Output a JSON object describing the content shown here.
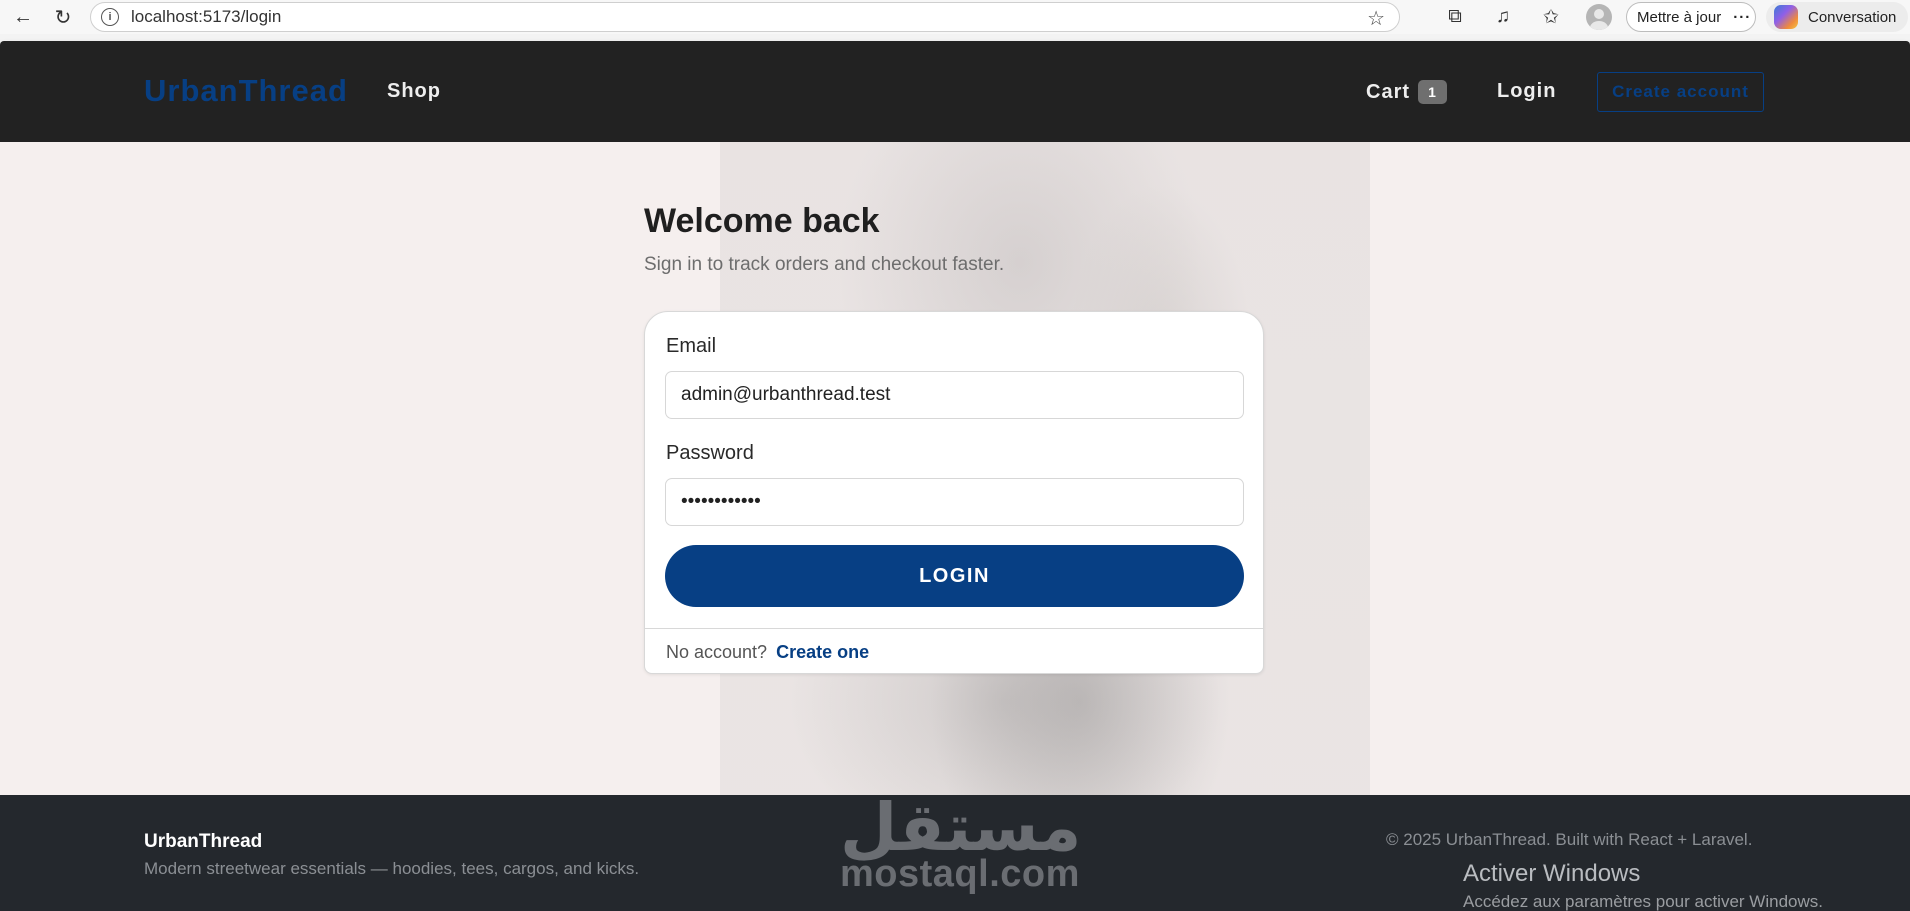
{
  "browser": {
    "url": "localhost:5173/login",
    "update_label": "Mettre à jour",
    "update_more": "···",
    "conversation_label": "Conversation",
    "icons": [
      "back-arrow-icon",
      "reload-icon",
      "info-icon",
      "star-icon",
      "extensions-icon",
      "media-icon",
      "favorites-icon",
      "profile-avatar",
      "copilot-icon"
    ]
  },
  "header": {
    "brand": "UrbanThread",
    "nav": {
      "shop": "Shop",
      "cart": "Cart",
      "cart_count": "1",
      "login": "Login",
      "create_account": "Create account"
    }
  },
  "login": {
    "title": "Welcome back",
    "subtitle": "Sign in to track orders and checkout faster.",
    "email_label": "Email",
    "email_value": "admin@urbanthread.test",
    "password_label": "Password",
    "password_value": "••••••••••••",
    "submit_label": "LOGIN",
    "footer_prompt": "No account?",
    "footer_link": "Create one"
  },
  "footer": {
    "brand": "UrbanThread",
    "tagline": "Modern streetwear essentials — hoodies, tees, cargos, and kicks.",
    "copyright": "© 2025 UrbanThread. Built with React + Laravel."
  },
  "watermark": {
    "arabic": "مستقل",
    "latin": "mostaql.com"
  },
  "os_notice": {
    "title": "Activer Windows",
    "subtitle": "Accédez aux paramètres pour activer Windows."
  },
  "colors": {
    "brand_blue": "#073f84",
    "header_bg": "#222222",
    "footer_bg": "#24282d"
  }
}
